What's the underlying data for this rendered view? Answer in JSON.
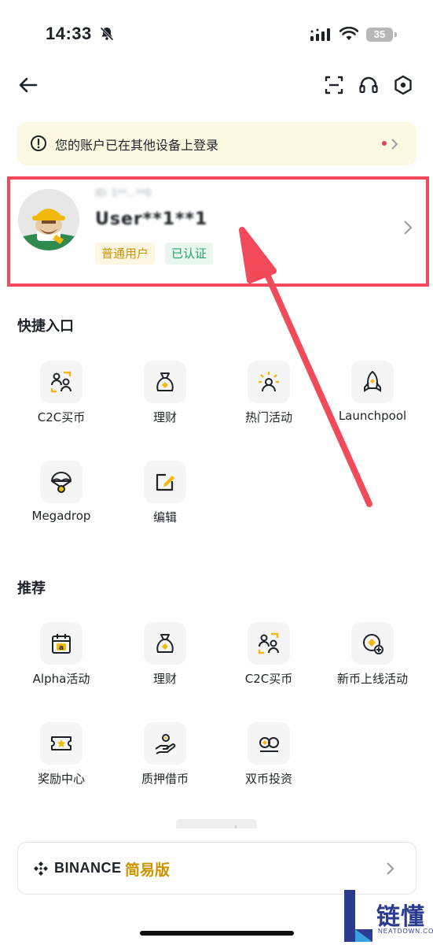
{
  "status_bar": {
    "time": "14:33",
    "battery": "35"
  },
  "notice": {
    "text": "您的账户已在其他设备上登录"
  },
  "profile": {
    "uid_masked": "ID: 1**...**0",
    "username_masked": "User**1**1",
    "badges": {
      "vip": "普通用户",
      "kyc": "已认证"
    }
  },
  "quick_entry": {
    "title": "快捷入口",
    "items": [
      {
        "label": "C2C买币",
        "icon": "c2c-users-icon"
      },
      {
        "label": "理财",
        "icon": "money-bag-icon"
      },
      {
        "label": "热门活动",
        "icon": "hot-event-icon"
      },
      {
        "label": "Launchpool",
        "icon": "rocket-icon"
      },
      {
        "label": "Megadrop",
        "icon": "parachute-icon"
      },
      {
        "label": "编辑",
        "icon": "edit-icon"
      }
    ]
  },
  "recommend": {
    "title": "推荐",
    "items": [
      {
        "label": "Alpha活动",
        "icon": "alpha-calendar-icon"
      },
      {
        "label": "理财",
        "icon": "money-bag-icon"
      },
      {
        "label": "C2C买币",
        "icon": "c2c-users-icon"
      },
      {
        "label": "新币上线活动",
        "icon": "new-coin-icon"
      },
      {
        "label": "奖励中心",
        "icon": "ticket-icon"
      },
      {
        "label": "质押借币",
        "icon": "loan-hand-icon"
      },
      {
        "label": "双币投资",
        "icon": "dual-coin-icon"
      }
    ]
  },
  "lite": {
    "brand": "BINANCE",
    "mode": "简易版"
  },
  "watermark": {
    "title": "链懂",
    "subtitle": "NEATDOWN.COM"
  },
  "colors": {
    "accent": "#F0B90B",
    "gold_text": "#C99400",
    "highlight_box": "#F04A5B",
    "verified": "#1FA36B"
  }
}
